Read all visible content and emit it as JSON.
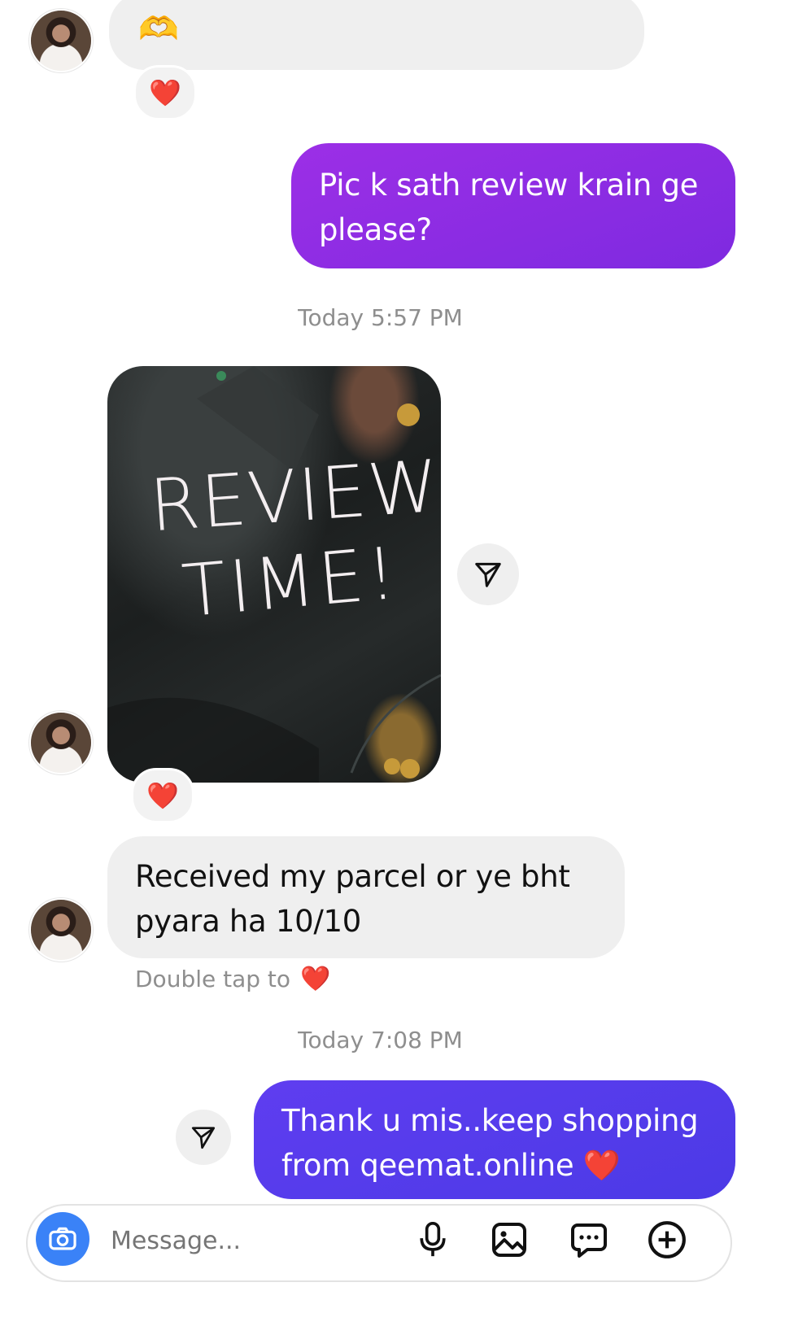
{
  "messages": {
    "m1": {
      "emoji": "🫶",
      "reaction": "❤️"
    },
    "m2": {
      "text": "Pic k sath review krain ge please?"
    },
    "ts1": "Today 5:57 PM",
    "m3": {
      "image_text_line1": "REVIEW",
      "image_text_line2": "TIME!",
      "reaction": "❤️"
    },
    "m4": {
      "text": "Received my parcel or ye bht pyara ha 10/10"
    },
    "hint": {
      "text": "Double tap to",
      "emoji": "❤️"
    },
    "ts2": "Today 7:08 PM",
    "m5": {
      "text": "Thank u mis..keep shopping from qeemat.online ❤️"
    }
  },
  "composer": {
    "placeholder": "Message...",
    "icons": [
      "camera-icon",
      "microphone-icon",
      "image-icon",
      "sticker-icon",
      "plus-icon"
    ]
  },
  "colors": {
    "outgoing_purple": "#8a2be2",
    "outgoing_blue": "#5b3ee8",
    "incoming_bg": "#efefef",
    "camera_blue": "#3a82f7",
    "timestamp_gray": "#8e8e8e"
  }
}
